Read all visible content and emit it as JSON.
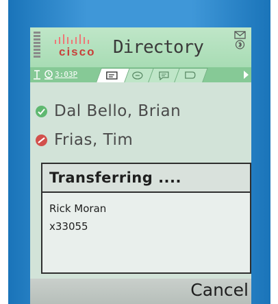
{
  "app": {
    "brand": "cisco",
    "title": "Directory"
  },
  "status": {
    "time": "3:03P",
    "icons": [
      "signal-strength-icon",
      "message-icon",
      "bluetooth-icon",
      "antenna-icon",
      "clock-icon"
    ]
  },
  "tabs": [
    {
      "icon": "directory-card-icon",
      "active": true
    },
    {
      "icon": "group-icon",
      "active": false
    },
    {
      "icon": "notes-icon",
      "active": false
    },
    {
      "icon": "chat-icon",
      "active": false
    }
  ],
  "contacts": [
    {
      "name": "Dal Bello, Brian",
      "status": "available",
      "status_color": "#5fb870"
    },
    {
      "name": "Frias, Tim",
      "status": "busy",
      "status_color": "#d2504c"
    }
  ],
  "dialog": {
    "title": "Transferring ....",
    "caller_name": "Rick Moran",
    "caller_ext": "x33055"
  },
  "softkeys": {
    "right": "Cancel"
  },
  "colors": {
    "bezel": "#3f97d8",
    "header": "#a8dcb4",
    "tabbar": "#86c996",
    "screen_bg": "#d2e3d8"
  }
}
